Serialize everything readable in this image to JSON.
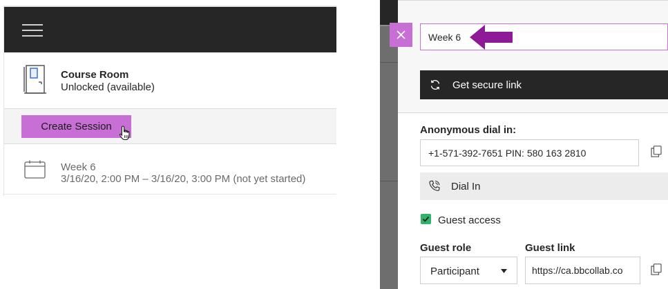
{
  "left": {
    "course_room": {
      "title": "Course Room",
      "status": "Unlocked (available)"
    },
    "create_session_label": "Create Session",
    "session": {
      "name": "Week 6",
      "time": "3/16/20, 2:00 PM – 3/16/20, 3:00 PM (not yet started)"
    }
  },
  "right": {
    "session_name_value": "Week 6",
    "secure_link_label": "Get secure link",
    "anonymous_dial_label": "Anonymous dial in:",
    "dial_number_value": "+1-571-392-7651 PIN: 580 163 2810",
    "dial_in_label": "Dial In",
    "guest_access": {
      "label": "Guest access",
      "checked": true
    },
    "guest_role_label": "Guest role",
    "guest_role_value": "Participant",
    "guest_link_label": "Guest link",
    "guest_link_value": "https://ca.bbcollab.co"
  },
  "icons": {
    "menu": "hamburger-icon",
    "door": "door-icon",
    "calendar": "calendar-icon",
    "cursor": "hand-cursor-icon",
    "close": "close-icon",
    "arrow": "arrow-left-icon",
    "sync": "sync-icon",
    "copy": "copy-icon",
    "phone": "phone-icon",
    "check": "checkmark-icon",
    "dropdown": "caret-down-icon"
  },
  "colors": {
    "accent_purple": "#c86fd6",
    "arrow_purple": "#8e1a98",
    "header_dark": "#262626",
    "checkbox_green": "#2db36c"
  }
}
